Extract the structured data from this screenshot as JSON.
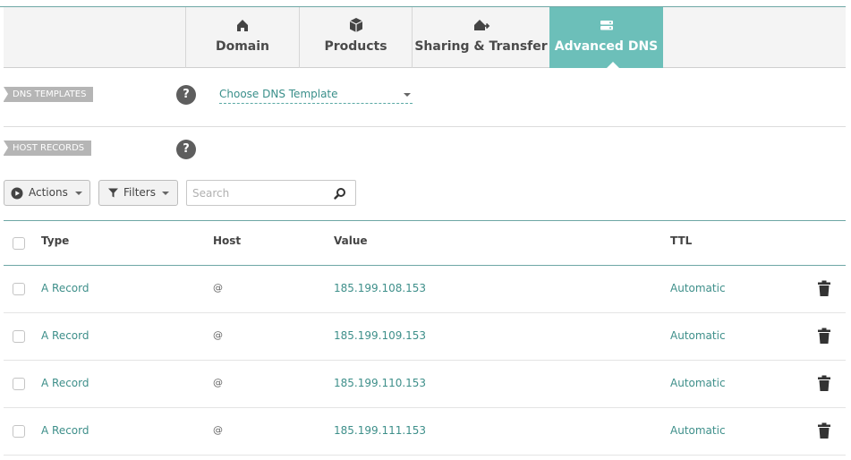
{
  "tabs": [
    {
      "label": "Domain",
      "icon": "home-icon",
      "active": false
    },
    {
      "label": "Products",
      "icon": "box-icon",
      "active": false
    },
    {
      "label": "Sharing & Transfer",
      "icon": "house-arrow-icon",
      "active": false
    },
    {
      "label": "Advanced DNS",
      "icon": "server-icon",
      "active": true
    }
  ],
  "dns_templates": {
    "tag": "DNS TEMPLATES",
    "help": "?",
    "select_value": "Choose DNS Template"
  },
  "host_records": {
    "tag": "HOST RECORDS",
    "help": "?"
  },
  "toolbar": {
    "actions_label": "Actions",
    "filters_label": "Filters",
    "search_placeholder": "Search"
  },
  "table": {
    "headers": {
      "type": "Type",
      "host": "Host",
      "value": "Value",
      "ttl": "TTL"
    },
    "rows": [
      {
        "type": "A Record",
        "host": "@",
        "value": "185.199.108.153",
        "ttl": "Automatic"
      },
      {
        "type": "A Record",
        "host": "@",
        "value": "185.199.109.153",
        "ttl": "Automatic"
      },
      {
        "type": "A Record",
        "host": "@",
        "value": "185.199.110.153",
        "ttl": "Automatic"
      },
      {
        "type": "A Record",
        "host": "@",
        "value": "185.199.111.153",
        "ttl": "Automatic"
      }
    ]
  },
  "colors": {
    "accent": "#6cbfb9",
    "link": "#3e8f8a",
    "tag_bg": "#b5b5b5"
  }
}
